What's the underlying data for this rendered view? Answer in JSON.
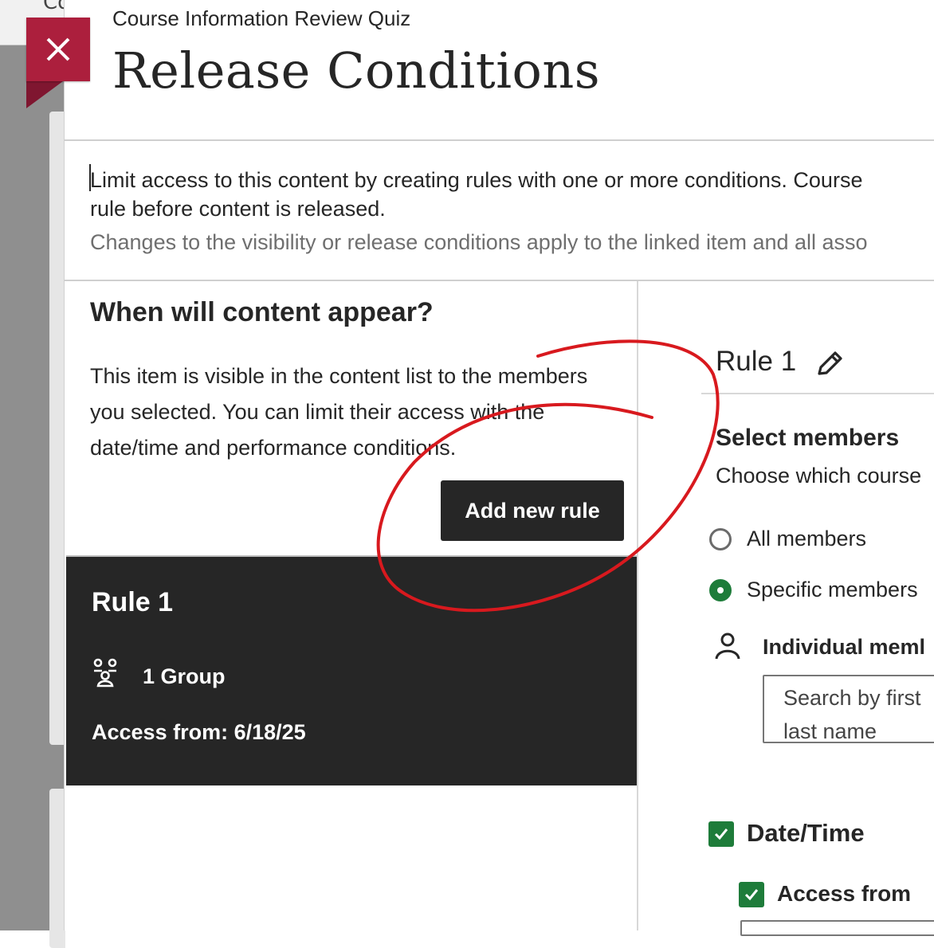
{
  "background": {
    "header_text": "Co"
  },
  "panel": {
    "subtitle": "Course Information Review Quiz",
    "title": "Release Conditions",
    "intro_line1": "Limit access to this content by creating rules with one or more conditions. Course",
    "intro_line2": "rule before content is released.",
    "intro_line3": "Changes to the visibility or release conditions apply to the linked item and all asso"
  },
  "left_column": {
    "heading": "When will content appear?",
    "description": "This item is visible in the content list to the members you selected. You can limit their access with the date/time and performance conditions.",
    "add_rule_label": "Add new rule",
    "rule_card": {
      "title": "Rule 1",
      "group_text": "1 Group",
      "access_text": "Access from: 6/18/25"
    }
  },
  "right_column": {
    "rule_title": "Rule 1",
    "select_heading": "Select members",
    "select_description": "Choose which course",
    "radio_all": "All members",
    "radio_specific": "Specific members",
    "individual_label": "Individual meml",
    "search_placeholder": "Search by first\nlast name",
    "datetime_label": "Date/Time",
    "access_from_label": "Access from"
  },
  "icons": {
    "close": "close-icon",
    "pencil": "pencil-icon",
    "group": "group-icon",
    "person": "person-icon",
    "check": "check-icon"
  },
  "colors": {
    "close_bg": "#ac1f3d",
    "dark": "#262626",
    "green": "#1e7c3a",
    "annotation_red": "#d8191e"
  }
}
